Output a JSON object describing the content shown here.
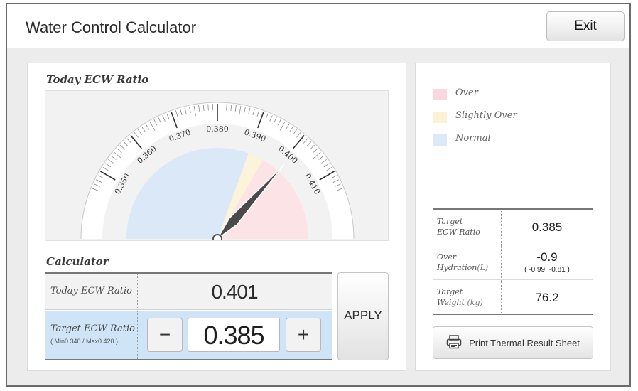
{
  "window": {
    "title": "Water Control Calculator",
    "exit_label": "Exit"
  },
  "gauge": {
    "title": "Today ECW Ratio",
    "tick_labels": [
      "0.350",
      "0.360",
      "0.370",
      "0.380",
      "0.390",
      "0.400",
      "0.410"
    ],
    "scale_min": 0.345,
    "scale_max": 0.415,
    "needle_value": 0.401,
    "zones": [
      {
        "name": "Normal",
        "from": 0.345,
        "to": 0.39,
        "color": "#dbe8f8"
      },
      {
        "name": "Slightly Over",
        "from": 0.39,
        "to": 0.395,
        "color": "#fbf3da"
      },
      {
        "name": "Over",
        "from": 0.395,
        "to": 0.415,
        "color": "#fbe3e6"
      }
    ]
  },
  "calculator": {
    "title": "Calculator",
    "today_label": "Today ECW Ratio",
    "today_value": "0.401",
    "target_label": "Target ECW Ratio",
    "target_range": "( Min0.340 / Max0.420 )",
    "target_value": "0.385",
    "minus_symbol": "−",
    "plus_symbol": "+",
    "apply_label": "APPLY"
  },
  "legend": [
    {
      "label": "Over",
      "color": "#fbd6db"
    },
    {
      "label": "Slightly Over",
      "color": "#fcf1d4"
    },
    {
      "label": "Normal",
      "color": "#dce9f8"
    }
  ],
  "results": {
    "target_ecw_label_1": "Target",
    "target_ecw_label_2": "ECW Ratio",
    "target_ecw_value": "0.385",
    "over_hydration_label_1": "Over",
    "over_hydration_label_2": "Hydration",
    "over_hydration_unit": "(L)",
    "over_hydration_value": "-0.9",
    "over_hydration_range": "( -0.99~-0.81 )",
    "target_weight_label_1": "Target",
    "target_weight_label_2": "Weight",
    "target_weight_unit": "(kg)",
    "target_weight_value": "76.2"
  },
  "print": {
    "label": "Print Thermal Result Sheet",
    "icon": "printer-icon"
  }
}
